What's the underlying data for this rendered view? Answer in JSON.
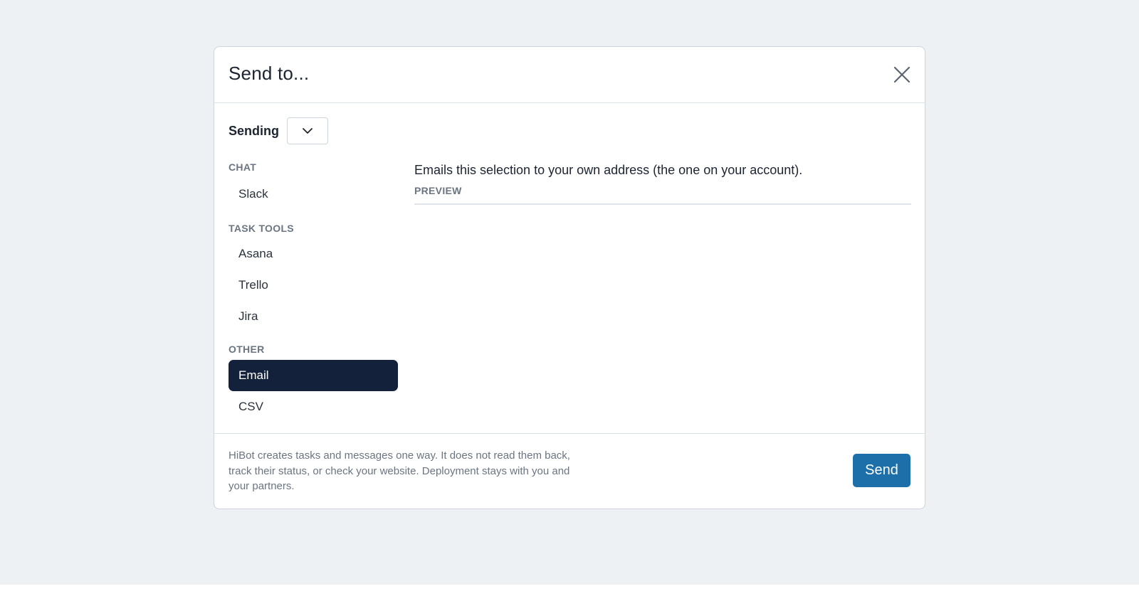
{
  "modal": {
    "title": "Send to...",
    "close_icon": "close-icon"
  },
  "sending": {
    "label": "Sending",
    "dropdown_icon": "chevron-down-icon"
  },
  "nav": {
    "groups": [
      {
        "label": "CHAT",
        "items": [
          "Slack"
        ]
      },
      {
        "label": "TASK TOOLS",
        "items": [
          "Asana",
          "Trello",
          "Jira"
        ]
      },
      {
        "label": "OTHER",
        "items": [
          "Email",
          "CSV"
        ]
      }
    ],
    "selected": "Email"
  },
  "content": {
    "description": "Emails this selection to your own address (the one on your account).",
    "preview_label": "PREVIEW"
  },
  "footer": {
    "note": "HiBot creates tasks and messages one way. It does not read them back, track their status, or check your website. Deployment stays with you and your partners.",
    "send_label": "Send"
  },
  "colors": {
    "backdrop": "#edf1f4",
    "selected_bg": "#14213a",
    "primary_button": "#1c6fa8"
  }
}
